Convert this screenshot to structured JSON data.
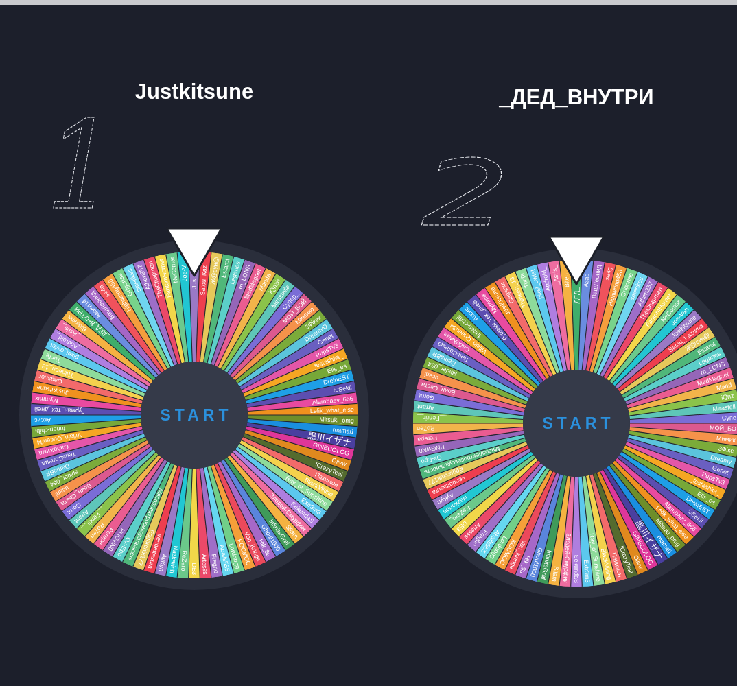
{
  "wheels": [
    {
      "title": "Justkitsune",
      "annotation": "1",
      "start_label": "START",
      "segments": [
        {
          "label": "Jus",
          "color": "#9a79c5"
        },
        {
          "label": "Satou_Kaz",
          "color": "#ee3e4e"
        },
        {
          "label": "Ж@сун@",
          "color": "#e6c85a"
        },
        {
          "label": "Estarot",
          "color": "#50b77a"
        },
        {
          "label": "Leganes",
          "color": "#5bcfc9"
        },
        {
          "label": "rn_LONS",
          "color": "#9566b8"
        },
        {
          "label": "MadMagnet",
          "color": "#ea5c90"
        },
        {
          "label": "Manda",
          "color": "#f2b44a"
        },
        {
          "label": "iQnzh",
          "color": "#8bc34a"
        },
        {
          "label": "Mirastella",
          "color": "#5ec6b8"
        },
        {
          "label": "Супер_",
          "color": "#7a6dd6"
        },
        {
          "label": "МОЙ_БОЙ",
          "color": "#dc598e"
        },
        {
          "label": "Мимико",
          "color": "#f5924a"
        },
        {
          "label": "3Фікек",
          "color": "#7bab3a"
        },
        {
          "label": "DreamyD",
          "color": "#5bc4dc"
        },
        {
          "label": "Genet",
          "color": "#6a5fc1"
        },
        {
          "label": "PupsTv3",
          "color": "#e456a8"
        },
        {
          "label": "_festashka_",
          "color": "#f5a623"
        },
        {
          "label": "Elis_es",
          "color": "#77a838"
        },
        {
          "label": "DreinEST",
          "color": "#1e9fe6"
        },
        {
          "label": "ඞSekii",
          "color": "#5c4eb0"
        },
        {
          "label": "Alambaev_666",
          "color": "#e84a9f"
        },
        {
          "label": "Lelik_what_else",
          "color": "#f0911e"
        },
        {
          "label": "Mitsuki_omg",
          "color": "#6e8e2a"
        },
        {
          "label": "mamaü",
          "color": "#1a8fe0"
        },
        {
          "label": "黒川イザナ",
          "color": "#4a3f9f"
        },
        {
          "label": "GINECOLOG",
          "color": "#df369a"
        },
        {
          "label": "Olivw",
          "color": "#e0891e"
        },
        {
          "label": "!CrazyTeal",
          "color": "#546b2e"
        },
        {
          "label": "Пакимон",
          "color": "#f26a6a"
        },
        {
          "label": "BlackViking",
          "color": "#f4d14c"
        },
        {
          "label": "Ray_of_Sunshine",
          "color": "#8edb9a"
        },
        {
          "label": "Extr3m3",
          "color": "#5cc8ee"
        },
        {
          "label": "SekundaS",
          "color": "#af7edf"
        },
        {
          "label": "Злодей-Смурфик",
          "color": "#ee6c9f"
        },
        {
          "label": "Sliam",
          "color": "#f5b241"
        },
        {
          "label": "InfiniteGraf",
          "color": "#3f9a5a"
        },
        {
          "label": "Ghoul1000",
          "color": "#5a85dc"
        },
        {
          "label": "Hik_$ь",
          "color": "#a668c8"
        },
        {
          "label": "Von_Kringe",
          "color": "#eb495b"
        },
        {
          "label": "KOCMOC",
          "color": "#f59f39"
        },
        {
          "label": "Lordopgg",
          "color": "#71cf89"
        },
        {
          "label": "Aballs555",
          "color": "#65d7f0"
        },
        {
          "label": "Fregho",
          "color": "#9f6fc7"
        },
        {
          "label": "Artesss",
          "color": "#eb4969"
        },
        {
          "label": "DE3",
          "color": "#f1d749"
        },
        {
          "label": "ReZero_",
          "color": "#6bc88a"
        },
        {
          "label": "Nazkarinh",
          "color": "#21c7d3"
        },
        {
          "label": "AyKyn",
          "color": "#9a79c6"
        },
        {
          "label": "vendettasura",
          "color": "#ee3e4f"
        },
        {
          "label": "Eggorchik177",
          "color": "#e6c85b"
        },
        {
          "label": "Мясоэлектросексуальность",
          "color": "#50b77b"
        },
        {
          "label": "Ox-Epo",
          "color": "#5bcfca"
        },
        {
          "label": "PNGviN0",
          "color": "#9566b9"
        },
        {
          "label": "Perepa",
          "color": "#ea5c91"
        },
        {
          "label": "Ro7en",
          "color": "#f2b44b"
        },
        {
          "label": "__Fenrir__",
          "color": "#8bc34b"
        },
        {
          "label": "Arrant",
          "color": "#5ec6b9"
        },
        {
          "label": "Gorot",
          "color": "#7a6dd7"
        },
        {
          "label": "Воин_Света",
          "color": "#dc598f"
        },
        {
          "label": "ucani",
          "color": "#f5924b"
        },
        {
          "label": "spider_064",
          "color": "#7bab3b"
        },
        {
          "label": "DamaBR",
          "color": "#5bc4dd"
        },
        {
          "label": "ТеньСолнца",
          "color": "#6a5fc2"
        },
        {
          "label": "СабоХима",
          "color": "#e456a9"
        },
        {
          "label": "Villain_Queen34",
          "color": "#f5a624"
        },
        {
          "label": "frinen-chibi",
          "color": "#77a839"
        },
        {
          "label": "Аксис",
          "color": "#1e9fe7"
        },
        {
          "label": "Гурман_тех_дней",
          "color": "#5c4eb1"
        },
        {
          "label": "Mymmix",
          "color": "#e84aa0"
        },
        {
          "label": "JustKitsune",
          "color": "#f0911f"
        },
        {
          "label": "Gagsnor",
          "color": "#f26a6b"
        },
        {
          "label": "Thirteen_13",
          "color": "#f4d14d"
        },
        {
          "label": "TurTe",
          "color": "#8edb9b"
        },
        {
          "label": "pixel_owlet",
          "color": "#5cc8ef"
        },
        {
          "label": "_Android_",
          "color": "#af7ee0"
        },
        {
          "label": "_Asris_",
          "color": "#ee6ca0"
        },
        {
          "label": "Bitenina",
          "color": "#f5b242"
        },
        {
          "label": "_ДЕД_ВНУТРИ",
          "color": "#3fae6b"
        },
        {
          "label": "Азаел14",
          "color": "#6a8de0"
        },
        {
          "label": "ВашЛеонид",
          "color": "#a566c6"
        },
        {
          "label": "se4g",
          "color": "#f0525c"
        },
        {
          "label": "Highwring458",
          "color": "#f59e3d"
        },
        {
          "label": "Grigorias",
          "color": "#78d38b"
        },
        {
          "label": "smerikes",
          "color": "#6fd5f0"
        },
        {
          "label": "Athen357",
          "color": "#9d6ec8"
        },
        {
          "label": "TheChapman",
          "color": "#eb4868"
        },
        {
          "label": "FantomHorner",
          "color": "#f3d64a"
        },
        {
          "label": "NeComar",
          "color": "#6bc98c"
        },
        {
          "label": "Joe-V",
          "color": "#22c6d2"
        }
      ]
    },
    {
      "title": "_ДЕД_ВНУТРИ",
      "annotation": "2",
      "start_label": "START",
      "segments": [
        {
          "label": "ДЕД_",
          "color": "#3fae6b"
        },
        {
          "label": "Азае",
          "color": "#6a8de0"
        },
        {
          "label": "ВашЛеонид",
          "color": "#a566c6"
        },
        {
          "label": "se4g",
          "color": "#f0525c"
        },
        {
          "label": "Highwring458",
          "color": "#f59e3d"
        },
        {
          "label": "Grigorias",
          "color": "#78d38b"
        },
        {
          "label": "smerikes",
          "color": "#6fd5f0"
        },
        {
          "label": "Athen357",
          "color": "#9d6ec8"
        },
        {
          "label": "TheChapman",
          "color": "#eb4868"
        },
        {
          "label": "FantomHorner",
          "color": "#f3d64a"
        },
        {
          "label": "NeComar",
          "color": "#6bc98c"
        },
        {
          "label": "Joe-Van",
          "color": "#22c6d2"
        },
        {
          "label": "Justkitsune",
          "color": "#9a79c5"
        },
        {
          "label": "Satou_Kazuma",
          "color": "#ee3e4e"
        },
        {
          "label": "Ж@сун@",
          "color": "#e6c85a"
        },
        {
          "label": "Estarot",
          "color": "#50b77a"
        },
        {
          "label": "Leganes",
          "color": "#5bcfc9"
        },
        {
          "label": "rn_LONS",
          "color": "#9566b8"
        },
        {
          "label": "MadMagnet",
          "color": "#ea5c90"
        },
        {
          "label": "Mand",
          "color": "#f2b44a"
        },
        {
          "label": "iQnz",
          "color": "#8bc34a"
        },
        {
          "label": "Mirastell",
          "color": "#5ec6b8"
        },
        {
          "label": "Супе",
          "color": "#7a6dd6"
        },
        {
          "label": "МОЙ_БО",
          "color": "#dc598e"
        },
        {
          "label": "Мимик",
          "color": "#f5924a"
        },
        {
          "label": "3Фіке",
          "color": "#7bab3a"
        },
        {
          "label": "Dreamy",
          "color": "#5bc4dc"
        },
        {
          "label": "Genet",
          "color": "#6a5fc1"
        },
        {
          "label": "PupsTv3",
          "color": "#e456a8"
        },
        {
          "label": "_festashka_",
          "color": "#f5a623"
        },
        {
          "label": "Elis_es",
          "color": "#77a838"
        },
        {
          "label": "DreinEST",
          "color": "#1e9fe6"
        },
        {
          "label": "ඞSekii",
          "color": "#5c4eb0"
        },
        {
          "label": "Alambaev_666",
          "color": "#e84a9f"
        },
        {
          "label": "Lelik_what_else",
          "color": "#f0911e"
        },
        {
          "label": "Mitsuki_omg",
          "color": "#6e8e2a"
        },
        {
          "label": "mamaü",
          "color": "#1a8fe0"
        },
        {
          "label": "黒川イザナ",
          "color": "#4a3f9f"
        },
        {
          "label": "GINECOLOG",
          "color": "#df369a"
        },
        {
          "label": "Olivw",
          "color": "#e0891e"
        },
        {
          "label": "!CrazyTeal",
          "color": "#546b2e"
        },
        {
          "label": "Пакимон",
          "color": "#f26a6a"
        },
        {
          "label": "BlackViking",
          "color": "#f4d14c"
        },
        {
          "label": "Ray_of_Sunshine",
          "color": "#8edb9a"
        },
        {
          "label": "Extr3m3",
          "color": "#5cc8ee"
        },
        {
          "label": "SekundaS",
          "color": "#af7edf"
        },
        {
          "label": "Злодей-Смурфик",
          "color": "#ee6c9f"
        },
        {
          "label": "Sliam",
          "color": "#f5b241"
        },
        {
          "label": "InfiniteGraf",
          "color": "#3f9a5a"
        },
        {
          "label": "Ghoul1000",
          "color": "#5a85dc"
        },
        {
          "label": "Hik_$ь",
          "color": "#a668c8"
        },
        {
          "label": "Von_Kringe",
          "color": "#eb495b"
        },
        {
          "label": "KOCMOC",
          "color": "#f59f39"
        },
        {
          "label": "Lordopgg",
          "color": "#71cf89"
        },
        {
          "label": "Aballs555",
          "color": "#65d7f0"
        },
        {
          "label": "Fregho",
          "color": "#9f6fc7"
        },
        {
          "label": "Artesss",
          "color": "#eb4969"
        },
        {
          "label": "DE3",
          "color": "#f1d749"
        },
        {
          "label": "ReZero_",
          "color": "#6bc88a"
        },
        {
          "label": "Nazkarinh",
          "color": "#21c7d3"
        },
        {
          "label": "AyKyn",
          "color": "#9a79c6"
        },
        {
          "label": "vendettasura",
          "color": "#ee3e4f"
        },
        {
          "label": "Eggorchik177",
          "color": "#e6c85b"
        },
        {
          "label": "Мясоэлектросексуальность",
          "color": "#50b77b"
        },
        {
          "label": "Ox-Epo",
          "color": "#5bcfca"
        },
        {
          "label": "PNGviN0",
          "color": "#9566b9"
        },
        {
          "label": "Perepa",
          "color": "#ea5c91"
        },
        {
          "label": "Ro7en",
          "color": "#f2b44b"
        },
        {
          "label": "__Fenrir__",
          "color": "#8bc34b"
        },
        {
          "label": "Arrant",
          "color": "#5ec6b9"
        },
        {
          "label": "Gorot",
          "color": "#7a6dd7"
        },
        {
          "label": "Воин_Света",
          "color": "#dc598f"
        },
        {
          "label": "ucani",
          "color": "#f5924b"
        },
        {
          "label": "spider_064",
          "color": "#7bab3b"
        },
        {
          "label": "DamaBR",
          "color": "#5bc4dd"
        },
        {
          "label": "ТеньСолнца",
          "color": "#6a5fc2"
        },
        {
          "label": "СабоХима",
          "color": "#e456a9"
        },
        {
          "label": "Villain_Queen34",
          "color": "#f5a624"
        },
        {
          "label": "frinen-chibi",
          "color": "#77a839"
        },
        {
          "label": "Аксис",
          "color": "#1e9fe7"
        },
        {
          "label": "Гурман_тех_дней",
          "color": "#5c4eb1"
        },
        {
          "label": "Mymmix",
          "color": "#e84aa0"
        },
        {
          "label": "JustKitsune",
          "color": "#f0911f"
        },
        {
          "label": "Gagsnor",
          "color": "#f26a6b"
        },
        {
          "label": "Thirteen_13",
          "color": "#f4d14d"
        },
        {
          "label": "TurTe",
          "color": "#8edb9b"
        },
        {
          "label": "pixel_owlet",
          "color": "#5cc8ef"
        },
        {
          "label": "_Android_",
          "color": "#af7ee0"
        },
        {
          "label": "_Asris_",
          "color": "#ee6ca0"
        },
        {
          "label": "Biten",
          "color": "#f5b242"
        }
      ]
    }
  ]
}
